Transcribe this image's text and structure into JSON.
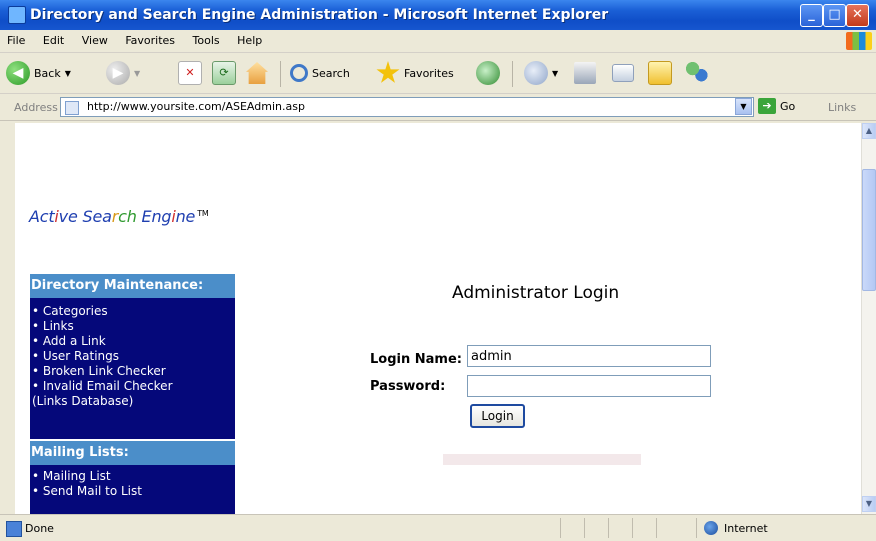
{
  "window": {
    "title": "Directory and Search Engine Administration - Microsoft Internet Explorer"
  },
  "menu": {
    "items": [
      "File",
      "Edit",
      "View",
      "Favorites",
      "Tools",
      "Help"
    ]
  },
  "toolbar": {
    "back_label": "Back",
    "search_label": "Search",
    "favorites_label": "Favorites"
  },
  "address": {
    "label": "Address",
    "url": "http://www.yoursite.com/ASEAdmin.asp",
    "go_label": "Go",
    "links_label": "Links"
  },
  "page": {
    "logo": {
      "parts": [
        {
          "text": "Act",
          "color": "#1f3fb0"
        },
        {
          "text": "i",
          "color": "#d03030"
        },
        {
          "text": "ve ",
          "color": "#1f3fb0"
        },
        {
          "text": "Sea",
          "color": "#1f3fb0"
        },
        {
          "text": "r",
          "color": "#d89a1a"
        },
        {
          "text": "ch ",
          "color": "#2f9a2f"
        },
        {
          "text": "Eng",
          "color": "#1f3fb0"
        },
        {
          "text": "i",
          "color": "#d03030"
        },
        {
          "text": "ne",
          "color": "#1f3fb0"
        }
      ],
      "trademark": "TM"
    },
    "nav": {
      "sections": [
        {
          "heading": "Directory Maintenance:",
          "links": [
            "• Categories",
            "• Links",
            "• Add a Link",
            "• User Ratings",
            "• Broken Link Checker",
            "• Invalid Email Checker",
            "(Links Database)"
          ]
        },
        {
          "heading": "Mailing Lists:",
          "links": [
            "• Mailing List",
            "• Send Mail to List"
          ]
        }
      ]
    },
    "login": {
      "title": "Administrator Login",
      "login_name_label": "Login Name:",
      "login_name_value": "admin",
      "password_label": "Password:",
      "password_value": "",
      "button_label": "Login"
    }
  },
  "status": {
    "text": "Done",
    "zone": "Internet"
  },
  "colors": {
    "nav_heading_bg": "#4b8ec9",
    "nav_bg": "#05087a",
    "titlebar": "#1a5fd6"
  }
}
